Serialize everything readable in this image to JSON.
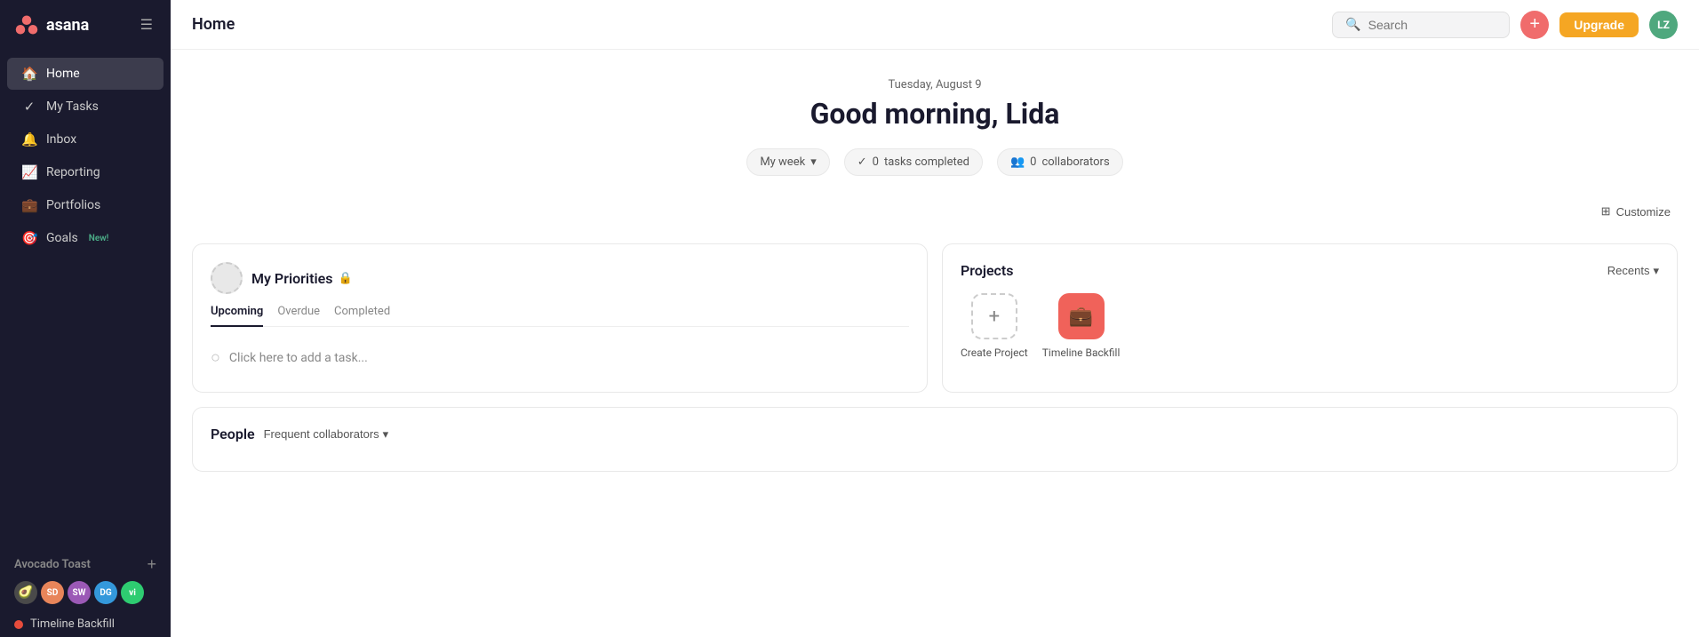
{
  "sidebar": {
    "logo_text": "asana",
    "nav_items": [
      {
        "id": "home",
        "label": "Home",
        "icon": "🏠",
        "active": true
      },
      {
        "id": "my-tasks",
        "label": "My Tasks",
        "icon": "✓"
      },
      {
        "id": "inbox",
        "label": "Inbox",
        "icon": "🔔"
      },
      {
        "id": "reporting",
        "label": "Reporting",
        "icon": "📈"
      },
      {
        "id": "portfolios",
        "label": "Portfolios",
        "icon": "💼"
      },
      {
        "id": "goals",
        "label": "Goals",
        "icon": "🎯",
        "badge": "New!"
      }
    ],
    "team_name": "Avocado Toast",
    "team_avatars": [
      {
        "initials": "🥑",
        "bg": "#4a4a4a"
      },
      {
        "initials": "SD",
        "bg": "#e8855a"
      },
      {
        "initials": "SW",
        "bg": "#9b59b6"
      },
      {
        "initials": "DG",
        "bg": "#3498db"
      },
      {
        "initials": "vi",
        "bg": "#2ecc71"
      }
    ],
    "projects": [
      {
        "id": "timeline-backfill",
        "name": "Timeline Backfill",
        "color": "#e74c3c"
      }
    ]
  },
  "topbar": {
    "title": "Home",
    "search_placeholder": "Search",
    "upgrade_label": "Upgrade",
    "user_initials": "LZ",
    "user_bg": "#4fa87e"
  },
  "hero": {
    "date": "Tuesday, August 9",
    "greeting": "Good morning, Lida",
    "my_week_label": "My week",
    "tasks_count": "0",
    "tasks_label": "tasks completed",
    "collaborators_count": "0",
    "collaborators_label": "collaborators",
    "customize_label": "Customize"
  },
  "my_priorities": {
    "title": "My Priorities",
    "lock_icon": "🔒",
    "tabs": [
      {
        "id": "upcoming",
        "label": "Upcoming",
        "active": true
      },
      {
        "id": "overdue",
        "label": "Overdue",
        "active": false
      },
      {
        "id": "completed",
        "label": "Completed",
        "active": false
      }
    ],
    "add_task_placeholder": "Click here to add a task..."
  },
  "projects": {
    "title": "Projects",
    "recents_label": "Recents",
    "create_project_label": "Create Project",
    "items": [
      {
        "id": "timeline-backfill",
        "name": "Timeline Backfill",
        "icon": "💼",
        "type": "filled"
      }
    ]
  },
  "people": {
    "title": "People",
    "freq_collab_label": "Frequent collaborators"
  }
}
